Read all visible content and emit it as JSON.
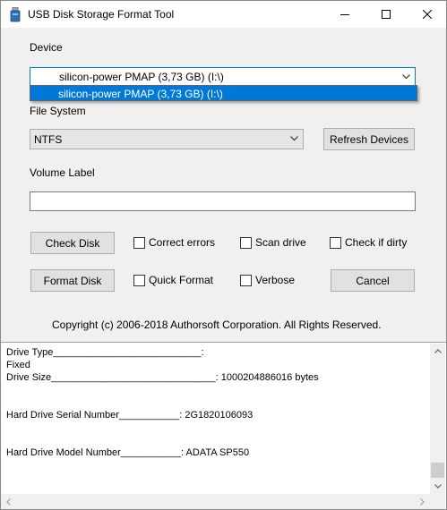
{
  "window": {
    "title": "USB Disk Storage Format Tool",
    "icon": "usb-drive-icon"
  },
  "device": {
    "label": "Device",
    "selected": "silicon-power  PMAP (3,73 GB) (I:\\)",
    "options": [
      "silicon-power  PMAP (3,73 GB) (I:\\)"
    ]
  },
  "file_system": {
    "label": "File System",
    "selected": "NTFS",
    "refresh_label": "Refresh Devices"
  },
  "volume_label": {
    "label": "Volume Label",
    "value": ""
  },
  "actions": {
    "check_disk": "Check Disk",
    "format_disk": "Format Disk",
    "cancel": "Cancel",
    "correct_errors": "Correct errors",
    "scan_drive": "Scan drive",
    "check_if_dirty": "Check if dirty",
    "quick_format": "Quick Format",
    "verbose": "Verbose"
  },
  "copyright": "Copyright (c) 2006-2018 Authorsoft Corporation. All Rights Reserved.",
  "log": {
    "text": "Drive Type___________________________:\nFixed\nDrive Size______________________________: 1000204886016 bytes\n\n\nHard Drive Serial Number___________: 2G1820106093\n\n\nHard Drive Model Number___________: ADATA SP550"
  },
  "colors": {
    "accent": "#0078d7",
    "window_bg": "#f0f0f0",
    "button_bg": "#e1e1e1"
  }
}
